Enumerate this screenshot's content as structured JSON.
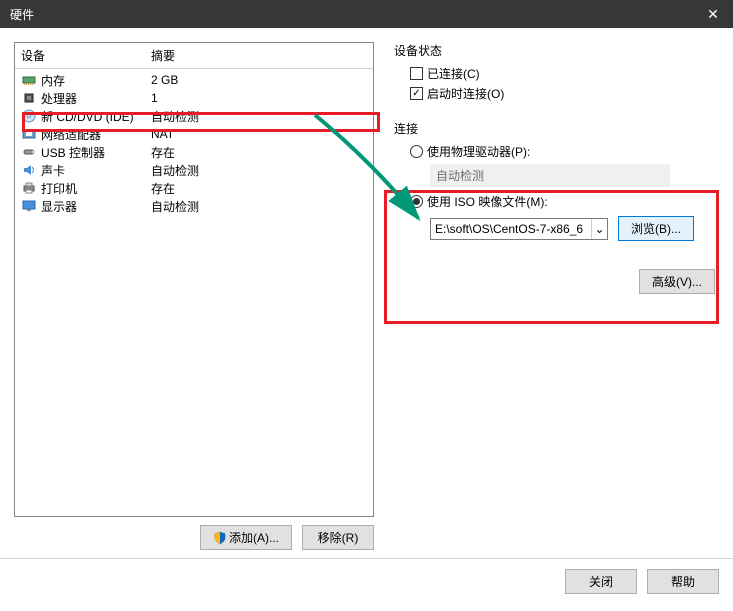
{
  "title": "硬件",
  "columns": {
    "device": "设备",
    "summary": "摘要"
  },
  "devices": [
    {
      "name": "内存",
      "summary": "2 GB",
      "icon": "memory"
    },
    {
      "name": "处理器",
      "summary": "1",
      "icon": "cpu"
    },
    {
      "name": "新 CD/DVD (IDE)",
      "summary": "自动检测",
      "icon": "disc"
    },
    {
      "name": "网络适配器",
      "summary": "NAT",
      "icon": "net"
    },
    {
      "name": "USB 控制器",
      "summary": "存在",
      "icon": "usb"
    },
    {
      "name": "声卡",
      "summary": "自动检测",
      "icon": "sound"
    },
    {
      "name": "打印机",
      "summary": "存在",
      "icon": "printer"
    },
    {
      "name": "显示器",
      "summary": "自动检测",
      "icon": "display"
    }
  ],
  "leftButtons": {
    "add": "添加(A)...",
    "remove": "移除(R)"
  },
  "right": {
    "statusLabel": "设备状态",
    "connected": "已连接(C)",
    "startupConnect": "启动时连接(O)",
    "connectionLabel": "连接",
    "usePhysical": "使用物理驱动器(P):",
    "autoDetect": "自动检测",
    "useIso": "使用 ISO 映像文件(M):",
    "isoPath": "E:\\soft\\OS\\CentOS-7-x86_6",
    "browse": "浏览(B)...",
    "advanced": "高级(V)..."
  },
  "footer": {
    "close": "关闭",
    "help": "帮助"
  }
}
